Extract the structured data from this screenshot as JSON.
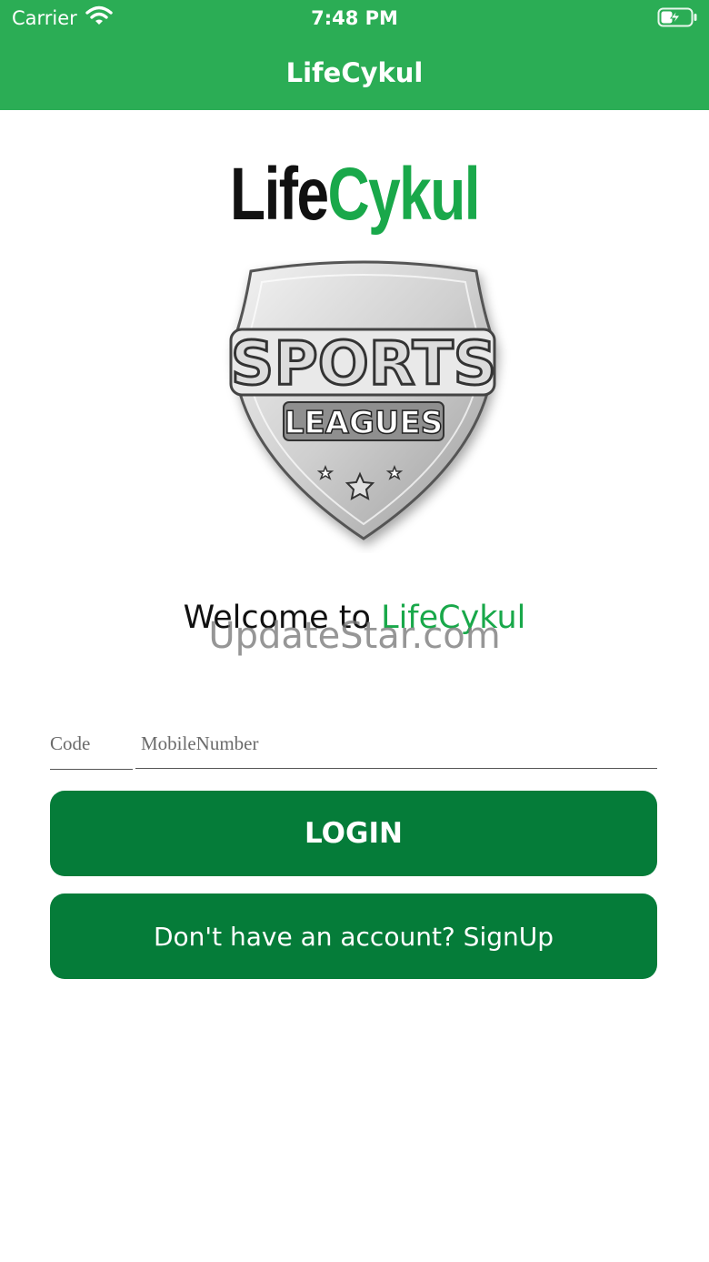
{
  "status_bar": {
    "carrier": "Carrier",
    "time": "7:48 PM",
    "icons": [
      "wifi-icon",
      "battery-charging-icon"
    ]
  },
  "nav": {
    "title": "LifeCykul"
  },
  "logo": {
    "part1": "Life",
    "part2": "Cykul",
    "badge_line1": "SPORTS",
    "badge_line2": "LEAGUES"
  },
  "welcome": {
    "prefix": "Welcome to",
    "brand": "LifeCykul"
  },
  "watermark": "UpdateStar.com",
  "form": {
    "code_placeholder": "Code",
    "mobile_placeholder": "MobileNumber",
    "code_value": "",
    "mobile_value": ""
  },
  "buttons": {
    "login_label": "LOGIN",
    "signup_label": "Don't have an account? SignUp"
  },
  "colors": {
    "header_green": "#2bad55",
    "button_green": "#057c39",
    "brand_green": "#19a84a"
  }
}
